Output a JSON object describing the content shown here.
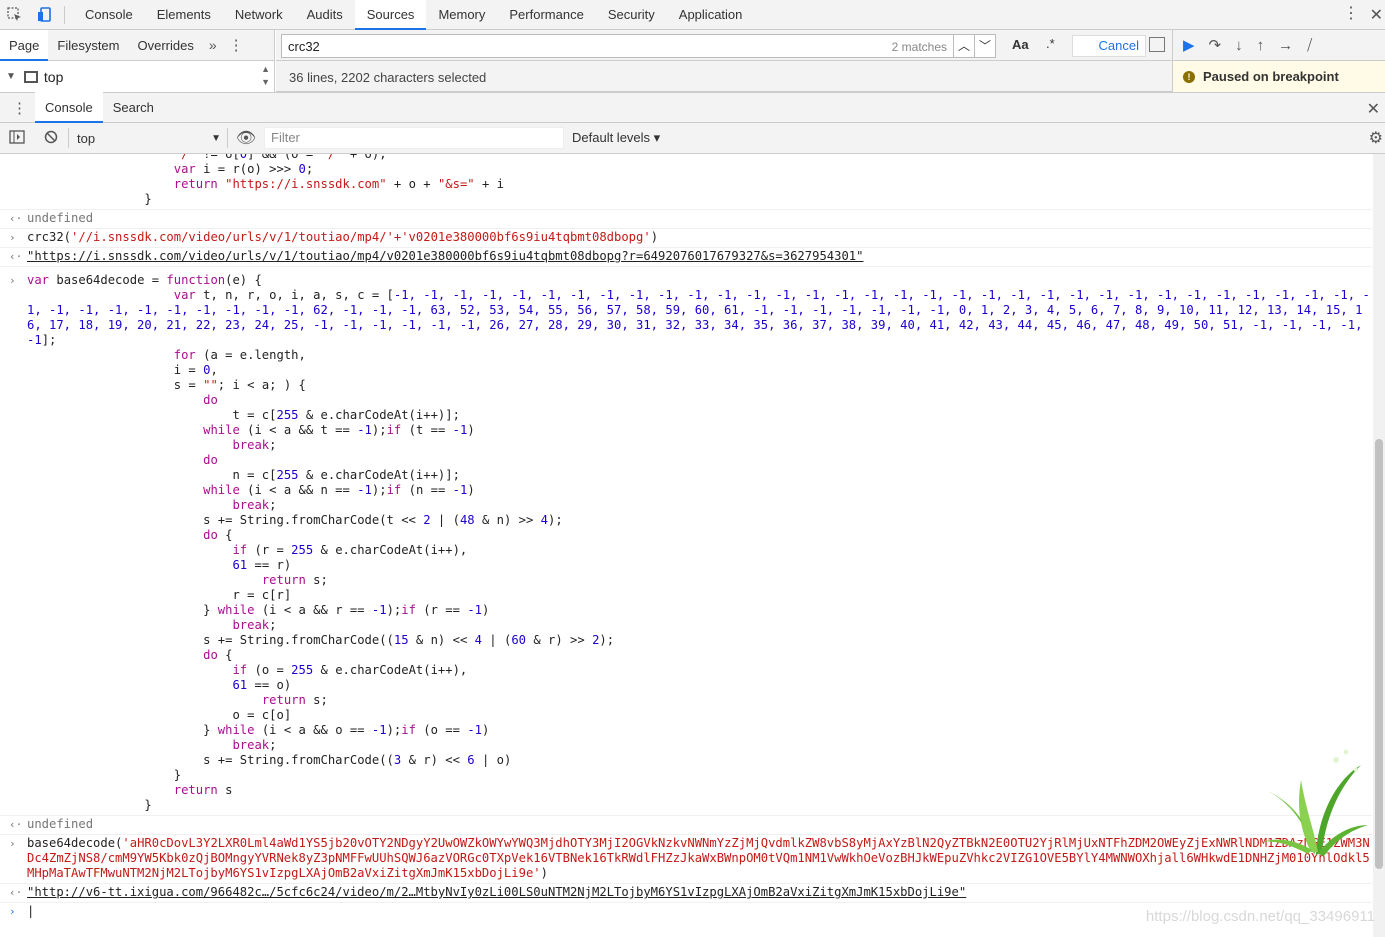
{
  "topbar": {
    "tabs": [
      "Console",
      "Elements",
      "Network",
      "Audits",
      "Sources",
      "Memory",
      "Performance",
      "Security",
      "Application"
    ],
    "active": "Sources",
    "icons": [
      "inspect-element-icon",
      "device-toolbar-icon",
      "kebab-menu-icon",
      "close-icon"
    ]
  },
  "navigator": {
    "tabs": [
      "Page",
      "Filesystem",
      "Overrides"
    ],
    "more": "»",
    "tree_item": "top"
  },
  "search": {
    "value": "crc32",
    "matches": "2 matches",
    "case_label": "Aa",
    "regex_label": ".*",
    "cancel": "Cancel"
  },
  "status": {
    "selection": "36 lines, 2202 characters selected"
  },
  "debugger": {
    "paused_text": "Paused on breakpoint",
    "controls": [
      "resume-icon",
      "step-over-icon",
      "step-into-icon",
      "step-out-icon",
      "step-icon",
      "deactivate-breakpoints-icon"
    ]
  },
  "drawer": {
    "tabs": [
      "Console",
      "Search"
    ]
  },
  "console_toolbar": {
    "context": "top",
    "filter_placeholder": "Filter",
    "levels": "Default levels"
  },
  "console": {
    "undefined": "undefined",
    "crc_call_prefix": "crc32(",
    "crc_call_args": "'//i.snssdk.com/video/urls/v/1/toutiao/mp4/'+'v0201e380000bf6s9iu4tqbmt08dbopg'",
    "crc_call_suffix": ")",
    "crc_result": "\"https://i.snssdk.com/video/urls/v/1/toutiao/mp4/v0201e380000bf6s9iu4tqbmt08dbopg?r=6492076017679327&s=3627954301\"",
    "b64_call_prefix": "base64decode(",
    "b64_arg": "'aHR0cDovL3Y2LXR0Lml4aWd1YS5jb20vOTY2NDgyY2UwOWZkOWYwYWQ3MjdhOTY3MjI2OGVkNzkvNWNmYzZjMjQvdmlkZW8vbS8yMjAxYzBlN2QyZTBkN2E0OTU2YjRlMjUxNTFhZDM2OWEyZjExNWRlNDM1ZDAzNGE1ZWM3NDc4ZmZjNS8/cmM9YW5Kbk0zQjBOMngyYVRNek8yZ3pNMFFwUUhSQWJ6azVORGc0TXpVek16VTBNek16TkRWdlFHZzJkaWxBWnpOM0tVQm1NM1VwWkhOeVozBHJkWEpuZVhkc2VIZG1OVE5BYlY4MWNWOXhjall6WHkwdE1DNHZjM010YnlOdkl5MHpMaTAwTFMwuNTM2NjM2LTojbyM6YS1vIzpgLXAjOmB2aVxiZitgXmJmK15xbDojLi9e'",
    "b64_call_suffix": ")",
    "b64_result": "\"http://v6-tt.ixigua.com/966482c…/5cfc6c24/video/m/2…MtbyNvIy0zLi00LS0uNTM2NjM2LTojbyM6YS1vIzpgLXAjOmB2aVxiZitgXmJmK15xbDojLi9e\""
  },
  "watermark": "https://blog.csdn.net/qq_33496911",
  "colors": {
    "accent": "#1a73e8",
    "keyword": "#aa0d91",
    "string": "#c41a16",
    "number": "#1c00cf",
    "paused_bg": "#fffbe6"
  }
}
